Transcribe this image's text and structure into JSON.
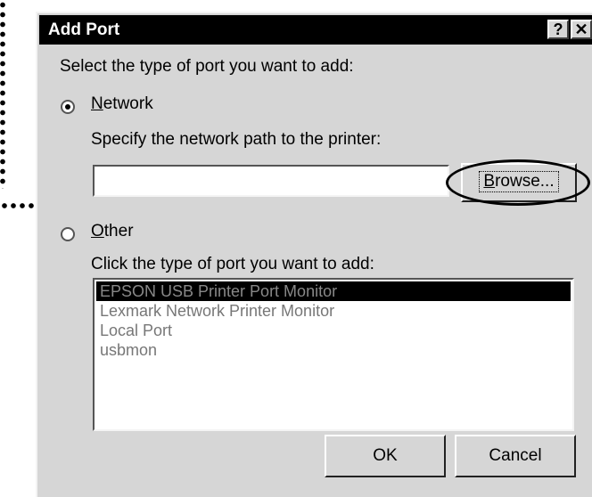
{
  "dialog": {
    "title": "Add Port",
    "help_label": "?",
    "close_label": "✕"
  },
  "prompt": "Select the type of port you want to add:",
  "network": {
    "label_first": "N",
    "label_rest": "etwork",
    "selected": true,
    "path_label": "Specify the network path to the printer:",
    "path_value": "",
    "browse_first": "B",
    "browse_rest": "rowse..."
  },
  "other": {
    "label_first": "O",
    "label_rest": "ther",
    "selected": false,
    "list_label": "Click the type of port you want to add:",
    "ports": [
      "EPSON USB Printer Port Monitor",
      "Lexmark Network Printer Monitor",
      "Local Port",
      "usbmon"
    ],
    "selected_port": "EPSON USB Printer Port Monitor"
  },
  "buttons": {
    "ok": "OK",
    "cancel": "Cancel"
  }
}
